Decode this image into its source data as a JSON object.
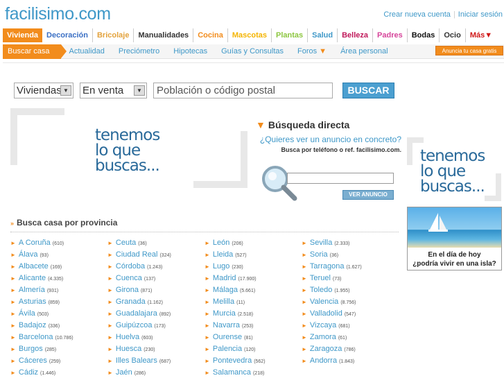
{
  "site": {
    "logo": "facilisimo.com"
  },
  "account": {
    "create": "Crear nueva cuenta",
    "login": "Iniciar sesión"
  },
  "categories": [
    {
      "label": "Vivienda",
      "color": "#ffffff"
    },
    {
      "label": "Decoración",
      "color": "#3a6fc4"
    },
    {
      "label": "Bricolaje",
      "color": "#e3a23c"
    },
    {
      "label": "Manualidades",
      "color": "#333333"
    },
    {
      "label": "Cocina",
      "color": "#f28c1c"
    },
    {
      "label": "Mascotas",
      "color": "#f4b400"
    },
    {
      "label": "Plantas",
      "color": "#8cc63f"
    },
    {
      "label": "Salud",
      "color": "#3f98c8"
    },
    {
      "label": "Belleza",
      "color": "#c0185a"
    },
    {
      "label": "Padres",
      "color": "#d6449a"
    },
    {
      "label": "Bodas",
      "color": "#111111"
    },
    {
      "label": "Ocio",
      "color": "#333333"
    },
    {
      "label": "Más▼",
      "color": "#d01818"
    }
  ],
  "subnav": {
    "active": "Buscar casa",
    "items": [
      "Actualidad",
      "Preciómetro",
      "Hipotecas",
      "Guías y Consultas",
      "Foros",
      "Área personal"
    ],
    "sell_button": "Anuncia tu casa gratis"
  },
  "search": {
    "type": "Viviendas",
    "mode": "En venta",
    "placeholder": "Población o código postal",
    "button": "BUSCAR"
  },
  "banner": {
    "line1": "tenemos",
    "line2": "lo que",
    "line3": "buscas..."
  },
  "direct": {
    "title": "Búsqueda directa",
    "question": "¿Quieres ver un anuncio en concreto?",
    "hint": "Busca por teléfono o ref. facilisimo.com.",
    "button": "VER ANUNCIO"
  },
  "island": {
    "line1": "En el día de hoy",
    "line2": "¿podría vivir en una isla?"
  },
  "provinces": {
    "title": "Busca casa por provincia",
    "columns": [
      [
        [
          "A Coruña",
          "(610)"
        ],
        [
          "Álava",
          "(93)"
        ],
        [
          "Albacete",
          "(169)"
        ],
        [
          "Alicante",
          "(4.335)"
        ],
        [
          "Almería",
          "(931)"
        ],
        [
          "Asturias",
          "(859)"
        ],
        [
          "Ávila",
          "(503)"
        ],
        [
          "Badajoz",
          "(336)"
        ],
        [
          "Barcelona",
          "(10.786)"
        ],
        [
          "Burgos",
          "(285)"
        ],
        [
          "Cáceres",
          "(259)"
        ],
        [
          "Cádiz",
          "(1.446)"
        ]
      ],
      [
        [
          "Ceuta",
          "(36)"
        ],
        [
          "Ciudad Real",
          "(324)"
        ],
        [
          "Córdoba",
          "(1.243)"
        ],
        [
          "Cuenca",
          "(137)"
        ],
        [
          "Girona",
          "(871)"
        ],
        [
          "Granada",
          "(1.162)"
        ],
        [
          "Guadalajara",
          "(892)"
        ],
        [
          "Guipúzcoa",
          "(173)"
        ],
        [
          "Huelva",
          "(603)"
        ],
        [
          "Huesca",
          "(230)"
        ],
        [
          "Illes Balears",
          "(687)"
        ],
        [
          "Jaén",
          "(286)"
        ]
      ],
      [
        [
          "León",
          "(206)"
        ],
        [
          "Lleida",
          "(527)"
        ],
        [
          "Lugo",
          "(230)"
        ],
        [
          "Madrid",
          "(17.900)"
        ],
        [
          "Málaga",
          "(5.661)"
        ],
        [
          "Melilla",
          "(11)"
        ],
        [
          "Murcia",
          "(2.518)"
        ],
        [
          "Navarra",
          "(253)"
        ],
        [
          "Ourense",
          "(81)"
        ],
        [
          "Palencia",
          "(120)"
        ],
        [
          "Pontevedra",
          "(562)"
        ],
        [
          "Salamanca",
          "(218)"
        ]
      ],
      [
        [
          "Sevilla",
          "(2.333)"
        ],
        [
          "Soria",
          "(36)"
        ],
        [
          "Tarragona",
          "(1.627)"
        ],
        [
          "Teruel",
          "(73)"
        ],
        [
          "Toledo",
          "(1.955)"
        ],
        [
          "Valencia",
          "(8.756)"
        ],
        [
          "Valladolid",
          "(547)"
        ],
        [
          "Vizcaya",
          "(681)"
        ],
        [
          "Zamora",
          "(61)"
        ],
        [
          "Zaragoza",
          "(786)"
        ],
        [
          "Andorra",
          "(1.843)"
        ]
      ]
    ]
  }
}
